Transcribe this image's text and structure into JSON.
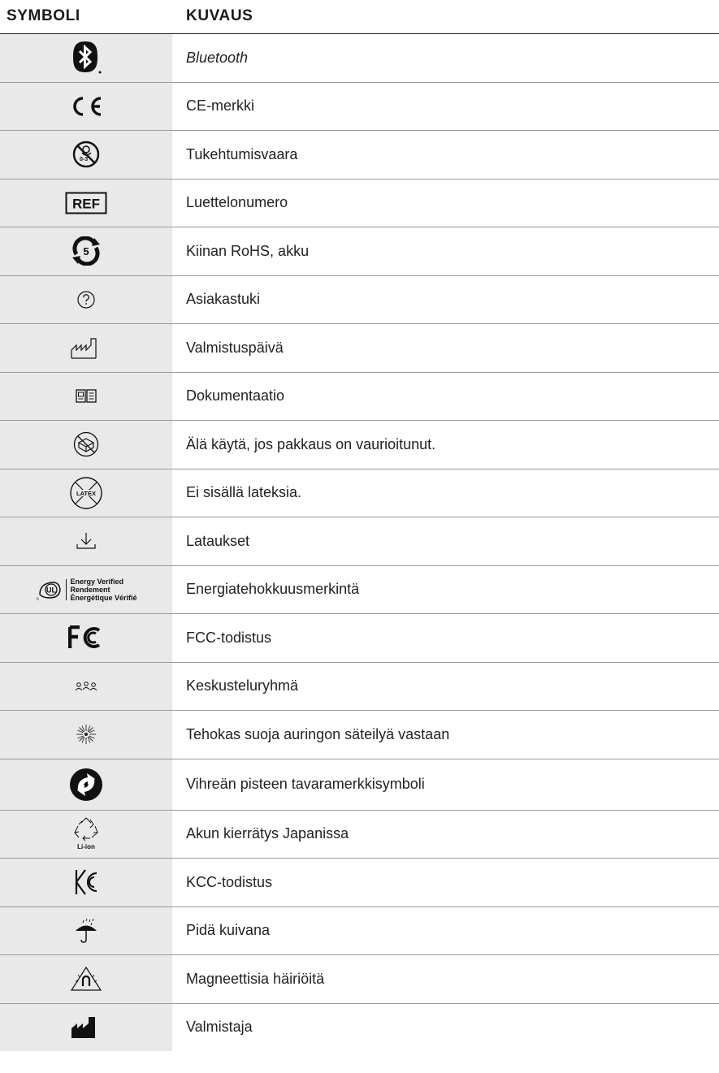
{
  "header": {
    "symbol_col": "SYMBOLI",
    "desc_col": "KUVAUS"
  },
  "rows": [
    {
      "icon": "bluetooth-icon",
      "label": "Bluetooth",
      "italic": true
    },
    {
      "icon": "ce-mark-icon",
      "label": "CE-merkki"
    },
    {
      "icon": "choking-hazard-icon",
      "label": "Tukehtumisvaara",
      "icon_text": "0-3"
    },
    {
      "icon": "ref-icon",
      "label": "Luettelonumero",
      "icon_text": "REF"
    },
    {
      "icon": "china-rohs-icon",
      "label": "Kiinan RoHS, akku",
      "icon_text": "5"
    },
    {
      "icon": "help-icon",
      "label": "Asiakastuki"
    },
    {
      "icon": "date-of-manufacture-icon",
      "label": "Valmistuspäivä"
    },
    {
      "icon": "documentation-icon",
      "label": "Dokumentaatio"
    },
    {
      "icon": "damaged-package-icon",
      "label": "Älä käytä, jos pakkaus on vaurioitunut."
    },
    {
      "icon": "latex-free-icon",
      "label": "Ei sisällä lateksia.",
      "icon_text": "LATEX"
    },
    {
      "icon": "download-icon",
      "label": "Lataukset"
    },
    {
      "icon": "ul-energy-verified-icon",
      "label": "Energiatehokkuusmerkintä",
      "icon_lines": [
        "Energy Verified",
        "Rendement",
        "Énergétique Vérifié"
      ]
    },
    {
      "icon": "fcc-icon",
      "label": "FCC-todistus"
    },
    {
      "icon": "community-icon",
      "label": "Keskusteluryhmä"
    },
    {
      "icon": "sun-protection-icon",
      "label": "Tehokas suoja auringon säteilyä vastaan"
    },
    {
      "icon": "green-dot-icon",
      "label": "Vihreän pisteen tavaramerkkisymboli"
    },
    {
      "icon": "li-ion-recycling-icon",
      "label": "Akun kierrätys Japanissa",
      "icon_text": "Li-ion"
    },
    {
      "icon": "kcc-icon",
      "label": "KCC-todistus"
    },
    {
      "icon": "keep-dry-icon",
      "label": "Pidä kuivana"
    },
    {
      "icon": "magnetic-interference-icon",
      "label": "Magneettisia häiriöitä"
    },
    {
      "icon": "manufacturer-icon",
      "label": "Valmistaja"
    }
  ]
}
